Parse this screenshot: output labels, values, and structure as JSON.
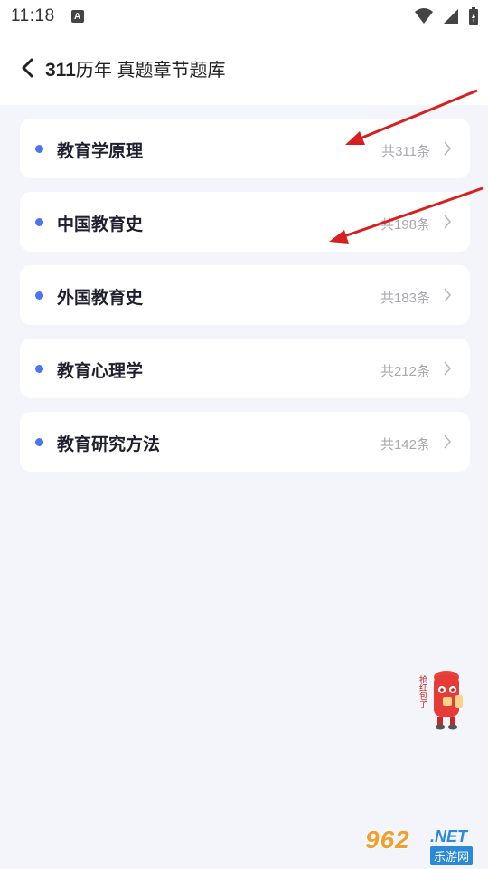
{
  "status_bar": {
    "time": "11:18",
    "notification_letter": "A"
  },
  "header": {
    "title_num": "311",
    "title_rest": "历年 真题章节题库"
  },
  "chapters": [
    {
      "title": "教育学原理",
      "count": "共311条"
    },
    {
      "title": "中国教育史",
      "count": "共198条"
    },
    {
      "title": "外国教育史",
      "count": "共183条"
    },
    {
      "title": "教育心理学",
      "count": "共212条"
    },
    {
      "title": "教育研究方法",
      "count": "共142条"
    }
  ],
  "colors": {
    "accent_dot": "#4a74f0",
    "annotation_arrow": "#d61f1f",
    "background": "#f4f5fa"
  },
  "mascot": {
    "icon": "red-envelope-mascot-icon",
    "caption": "抢红包了"
  },
  "watermark": {
    "brand_num": "962",
    "brand_suffix": ".NET",
    "subtitle": "乐游网"
  }
}
